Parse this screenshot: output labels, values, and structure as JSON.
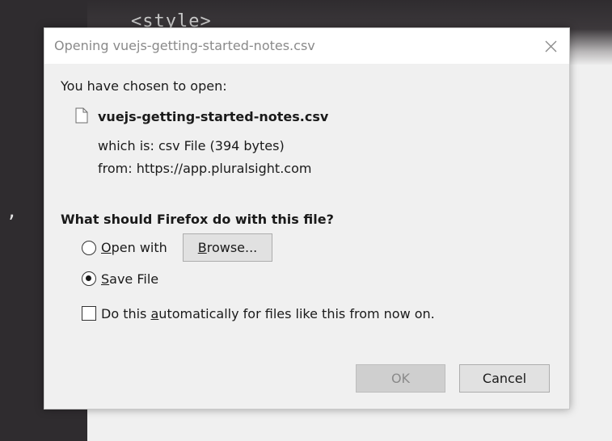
{
  "background": {
    "code_text": "<style>",
    "code_text_left": ","
  },
  "dialog": {
    "title": "Opening vuejs-getting-started-notes.csv",
    "intro": "You have chosen to open:",
    "filename": "vuejs-getting-started-notes.csv",
    "which_is_label": "which is:",
    "which_is_value": "csv File (394 bytes)",
    "from_label": "from:",
    "from_value": "https://app.pluralsight.com",
    "question": "What should Firefox do with this file?",
    "options": {
      "open_with": {
        "mnemonic": "O",
        "rest": "pen with",
        "selected": false
      },
      "save_file": {
        "mnemonic": "S",
        "rest": "ave File",
        "selected": true
      }
    },
    "browse_button": {
      "mnemonic": "B",
      "rest": "rowse..."
    },
    "auto_checkbox": {
      "before": "Do this ",
      "mnemonic": "a",
      "after": "utomatically for files like this from now on.",
      "checked": false
    },
    "ok_label": "OK",
    "cancel_label": "Cancel"
  }
}
